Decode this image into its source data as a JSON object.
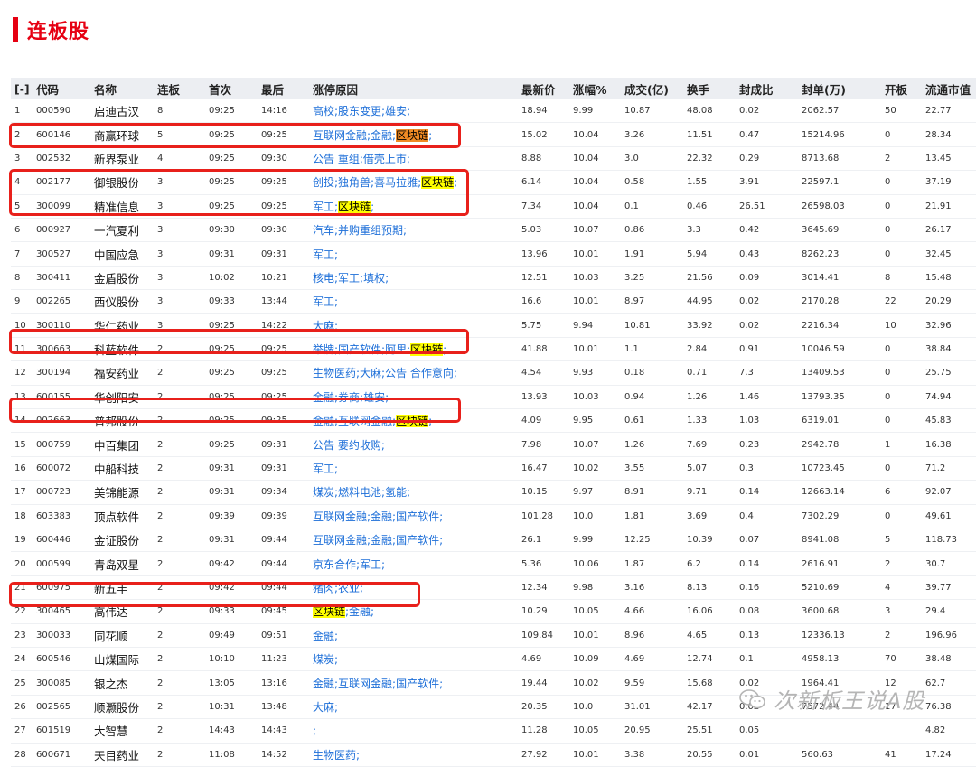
{
  "page": {
    "title": "连板股"
  },
  "columns": [
    "[-]",
    "代码",
    "名称",
    "连板",
    "首次",
    "最后",
    "涨停原因",
    "最新价",
    "涨幅%",
    "成交(亿)",
    "换手",
    "封成比",
    "封单(万)",
    "开板",
    "流通市值"
  ],
  "rows": [
    {
      "idx": "1",
      "code": "000590",
      "name": "启迪古汉",
      "lb": "8",
      "first": "09:25",
      "last": "14:16",
      "reason": [
        {
          "t": "高校;股东变更;雄安;"
        }
      ],
      "price": "18.94",
      "chg": "9.99",
      "amt": "10.87",
      "turn": "48.08",
      "ratio": "0.02",
      "seal": "2062.57",
      "open": "50",
      "cap": "22.77"
    },
    {
      "idx": "2",
      "code": "600146",
      "name": "商赢环球",
      "lb": "5",
      "first": "09:25",
      "last": "09:25",
      "reason": [
        {
          "t": "互联网金融;金融;"
        },
        {
          "t": "区块链",
          "h": "orange"
        },
        {
          "t": ";"
        }
      ],
      "price": "15.02",
      "chg": "10.04",
      "amt": "3.26",
      "turn": "11.51",
      "ratio": "0.47",
      "seal": "15214.96",
      "open": "0",
      "cap": "28.34"
    },
    {
      "idx": "3",
      "code": "002532",
      "name": "新界泵业",
      "lb": "4",
      "first": "09:25",
      "last": "09:30",
      "reason": [
        {
          "t": "公告 重组;借壳上市;"
        }
      ],
      "price": "8.88",
      "chg": "10.04",
      "amt": "3.0",
      "turn": "22.32",
      "ratio": "0.29",
      "seal": "8713.68",
      "open": "2",
      "cap": "13.45"
    },
    {
      "idx": "4",
      "code": "002177",
      "name": "御银股份",
      "lb": "3",
      "first": "09:25",
      "last": "09:25",
      "reason": [
        {
          "t": "创投;独角兽;喜马拉雅;"
        },
        {
          "t": "区块链",
          "h": "yellow"
        },
        {
          "t": ";"
        }
      ],
      "price": "6.14",
      "chg": "10.04",
      "amt": "0.58",
      "turn": "1.55",
      "ratio": "3.91",
      "seal": "22597.1",
      "open": "0",
      "cap": "37.19"
    },
    {
      "idx": "5",
      "code": "300099",
      "name": "精准信息",
      "lb": "3",
      "first": "09:25",
      "last": "09:25",
      "reason": [
        {
          "t": "军工;"
        },
        {
          "t": "区块链",
          "h": "yellow"
        },
        {
          "t": ";"
        }
      ],
      "price": "7.34",
      "chg": "10.04",
      "amt": "0.1",
      "turn": "0.46",
      "ratio": "26.51",
      "seal": "26598.03",
      "open": "0",
      "cap": "21.91"
    },
    {
      "idx": "6",
      "code": "000927",
      "name": "一汽夏利",
      "lb": "3",
      "first": "09:30",
      "last": "09:30",
      "reason": [
        {
          "t": "汽车;并购重组预期;"
        }
      ],
      "price": "5.03",
      "chg": "10.07",
      "amt": "0.86",
      "turn": "3.3",
      "ratio": "0.42",
      "seal": "3645.69",
      "open": "0",
      "cap": "26.17"
    },
    {
      "idx": "7",
      "code": "300527",
      "name": "中国应急",
      "lb": "3",
      "first": "09:31",
      "last": "09:31",
      "reason": [
        {
          "t": "军工;"
        }
      ],
      "price": "13.96",
      "chg": "10.01",
      "amt": "1.91",
      "turn": "5.94",
      "ratio": "0.43",
      "seal": "8262.23",
      "open": "0",
      "cap": "32.45"
    },
    {
      "idx": "8",
      "code": "300411",
      "name": "金盾股份",
      "lb": "3",
      "first": "10:02",
      "last": "10:21",
      "reason": [
        {
          "t": "核电;军工;填权;"
        }
      ],
      "price": "12.51",
      "chg": "10.03",
      "amt": "3.25",
      "turn": "21.56",
      "ratio": "0.09",
      "seal": "3014.41",
      "open": "8",
      "cap": "15.48"
    },
    {
      "idx": "9",
      "code": "002265",
      "name": "西仪股份",
      "lb": "3",
      "first": "09:33",
      "last": "13:44",
      "reason": [
        {
          "t": "军工;"
        }
      ],
      "price": "16.6",
      "chg": "10.01",
      "amt": "8.97",
      "turn": "44.95",
      "ratio": "0.02",
      "seal": "2170.28",
      "open": "22",
      "cap": "20.29"
    },
    {
      "idx": "10",
      "code": "300110",
      "name": "华仁药业",
      "lb": "3",
      "first": "09:25",
      "last": "14:22",
      "reason": [
        {
          "t": "大麻;"
        }
      ],
      "price": "5.75",
      "chg": "9.94",
      "amt": "10.81",
      "turn": "33.92",
      "ratio": "0.02",
      "seal": "2216.34",
      "open": "10",
      "cap": "32.96"
    },
    {
      "idx": "11",
      "code": "300663",
      "name": "科蓝软件",
      "lb": "2",
      "first": "09:25",
      "last": "09:25",
      "reason": [
        {
          "t": "举牌;国产软件;阿里;"
        },
        {
          "t": "区块链",
          "h": "yellow"
        },
        {
          "t": ";"
        }
      ],
      "price": "41.88",
      "chg": "10.01",
      "amt": "1.1",
      "turn": "2.84",
      "ratio": "0.91",
      "seal": "10046.59",
      "open": "0",
      "cap": "38.84"
    },
    {
      "idx": "12",
      "code": "300194",
      "name": "福安药业",
      "lb": "2",
      "first": "09:25",
      "last": "09:25",
      "reason": [
        {
          "t": "生物医药;大麻;公告 合作意向;"
        }
      ],
      "price": "4.54",
      "chg": "9.93",
      "amt": "0.18",
      "turn": "0.71",
      "ratio": "7.3",
      "seal": "13409.53",
      "open": "0",
      "cap": "25.75"
    },
    {
      "idx": "13",
      "code": "600155",
      "name": "华创阳安",
      "lb": "2",
      "first": "09:25",
      "last": "09:25",
      "reason": [
        {
          "t": "金融;券商;雄安;"
        }
      ],
      "price": "13.93",
      "chg": "10.03",
      "amt": "0.94",
      "turn": "1.26",
      "ratio": "1.46",
      "seal": "13793.35",
      "open": "0",
      "cap": "74.94"
    },
    {
      "idx": "14",
      "code": "002663",
      "name": "普邦股份",
      "lb": "2",
      "first": "09:25",
      "last": "09:25",
      "reason": [
        {
          "t": "金融;互联网金融;"
        },
        {
          "t": "区块链",
          "h": "yellow"
        },
        {
          "t": ";"
        }
      ],
      "price": "4.09",
      "chg": "9.95",
      "amt": "0.61",
      "turn": "1.33",
      "ratio": "1.03",
      "seal": "6319.01",
      "open": "0",
      "cap": "45.83"
    },
    {
      "idx": "15",
      "code": "000759",
      "name": "中百集团",
      "lb": "2",
      "first": "09:25",
      "last": "09:31",
      "reason": [
        {
          "t": "公告 要约收购;"
        }
      ],
      "price": "7.98",
      "chg": "10.07",
      "amt": "1.26",
      "turn": "7.69",
      "ratio": "0.23",
      "seal": "2942.78",
      "open": "1",
      "cap": "16.38"
    },
    {
      "idx": "16",
      "code": "600072",
      "name": "中船科技",
      "lb": "2",
      "first": "09:31",
      "last": "09:31",
      "reason": [
        {
          "t": "军工;"
        }
      ],
      "price": "16.47",
      "chg": "10.02",
      "amt": "3.55",
      "turn": "5.07",
      "ratio": "0.3",
      "seal": "10723.45",
      "open": "0",
      "cap": "71.2"
    },
    {
      "idx": "17",
      "code": "000723",
      "name": "美锦能源",
      "lb": "2",
      "first": "09:31",
      "last": "09:34",
      "reason": [
        {
          "t": "煤炭;燃料电池;氢能;"
        }
      ],
      "price": "10.15",
      "chg": "9.97",
      "amt": "8.91",
      "turn": "9.71",
      "ratio": "0.14",
      "seal": "12663.14",
      "open": "6",
      "cap": "92.07"
    },
    {
      "idx": "18",
      "code": "603383",
      "name": "顶点软件",
      "lb": "2",
      "first": "09:39",
      "last": "09:39",
      "reason": [
        {
          "t": "互联网金融;金融;国产软件;"
        }
      ],
      "price": "101.28",
      "chg": "10.0",
      "amt": "1.81",
      "turn": "3.69",
      "ratio": "0.4",
      "seal": "7302.29",
      "open": "0",
      "cap": "49.61"
    },
    {
      "idx": "19",
      "code": "600446",
      "name": "金证股份",
      "lb": "2",
      "first": "09:31",
      "last": "09:44",
      "reason": [
        {
          "t": "互联网金融;金融;国产软件;"
        }
      ],
      "price": "26.1",
      "chg": "9.99",
      "amt": "12.25",
      "turn": "10.39",
      "ratio": "0.07",
      "seal": "8941.08",
      "open": "5",
      "cap": "118.73"
    },
    {
      "idx": "20",
      "code": "000599",
      "name": "青岛双星",
      "lb": "2",
      "first": "09:42",
      "last": "09:44",
      "reason": [
        {
          "t": "京东合作;军工;"
        }
      ],
      "price": "5.36",
      "chg": "10.06",
      "amt": "1.87",
      "turn": "6.2",
      "ratio": "0.14",
      "seal": "2616.91",
      "open": "2",
      "cap": "30.7"
    },
    {
      "idx": "21",
      "code": "600975",
      "name": "新五丰",
      "lb": "2",
      "first": "09:42",
      "last": "09:44",
      "reason": [
        {
          "t": "猪肉;农业;"
        }
      ],
      "price": "12.34",
      "chg": "9.98",
      "amt": "3.16",
      "turn": "8.13",
      "ratio": "0.16",
      "seal": "5210.69",
      "open": "4",
      "cap": "39.77"
    },
    {
      "idx": "22",
      "code": "300465",
      "name": "高伟达",
      "lb": "2",
      "first": "09:33",
      "last": "09:45",
      "reason": [
        {
          "t": "区块链",
          "h": "yellow"
        },
        {
          "t": ";金融;"
        }
      ],
      "price": "10.29",
      "chg": "10.05",
      "amt": "4.66",
      "turn": "16.06",
      "ratio": "0.08",
      "seal": "3600.68",
      "open": "3",
      "cap": "29.4"
    },
    {
      "idx": "23",
      "code": "300033",
      "name": "同花顺",
      "lb": "2",
      "first": "09:49",
      "last": "09:51",
      "reason": [
        {
          "t": "金融;"
        }
      ],
      "price": "109.84",
      "chg": "10.01",
      "amt": "8.96",
      "turn": "4.65",
      "ratio": "0.13",
      "seal": "12336.13",
      "open": "2",
      "cap": "196.96"
    },
    {
      "idx": "24",
      "code": "600546",
      "name": "山煤国际",
      "lb": "2",
      "first": "10:10",
      "last": "11:23",
      "reason": [
        {
          "t": "煤炭;"
        }
      ],
      "price": "4.69",
      "chg": "10.09",
      "amt": "4.69",
      "turn": "12.74",
      "ratio": "0.1",
      "seal": "4958.13",
      "open": "70",
      "cap": "38.48"
    },
    {
      "idx": "25",
      "code": "300085",
      "name": "银之杰",
      "lb": "2",
      "first": "13:05",
      "last": "13:16",
      "reason": [
        {
          "t": "金融;互联网金融;国产软件;"
        }
      ],
      "price": "19.44",
      "chg": "10.02",
      "amt": "9.59",
      "turn": "15.68",
      "ratio": "0.02",
      "seal": "1964.41",
      "open": "12",
      "cap": "62.7"
    },
    {
      "idx": "26",
      "code": "002565",
      "name": "顺灏股份",
      "lb": "2",
      "first": "10:31",
      "last": "13:48",
      "reason": [
        {
          "t": "大麻;"
        }
      ],
      "price": "20.35",
      "chg": "10.0",
      "amt": "31.01",
      "turn": "42.17",
      "ratio": "0.02",
      "seal": "7572.44",
      "open": "17",
      "cap": "76.38"
    },
    {
      "idx": "27",
      "code": "601519",
      "name": "大智慧",
      "lb": "2",
      "first": "14:43",
      "last": "14:43",
      "reason": [
        {
          "t": ";"
        }
      ],
      "price": "11.28",
      "chg": "10.05",
      "amt": "20.95",
      "turn": "25.51",
      "ratio": "0.05",
      "seal": "",
      "open": "",
      "cap": "4.82"
    },
    {
      "idx": "28",
      "code": "600671",
      "name": "天目药业",
      "lb": "2",
      "first": "11:08",
      "last": "14:52",
      "reason": [
        {
          "t": "生物医药;"
        }
      ],
      "price": "27.92",
      "chg": "10.01",
      "amt": "3.38",
      "turn": "20.55",
      "ratio": "0.01",
      "seal": "560.63",
      "open": "41",
      "cap": "17.24"
    }
  ],
  "watermark": {
    "text": "次新板王说A股"
  },
  "colors": {
    "accent": "#e60012",
    "link": "#1c6ed8",
    "highlight": "#ffff00",
    "highlight_alt": "#f08a24",
    "box": "#e8201b"
  }
}
